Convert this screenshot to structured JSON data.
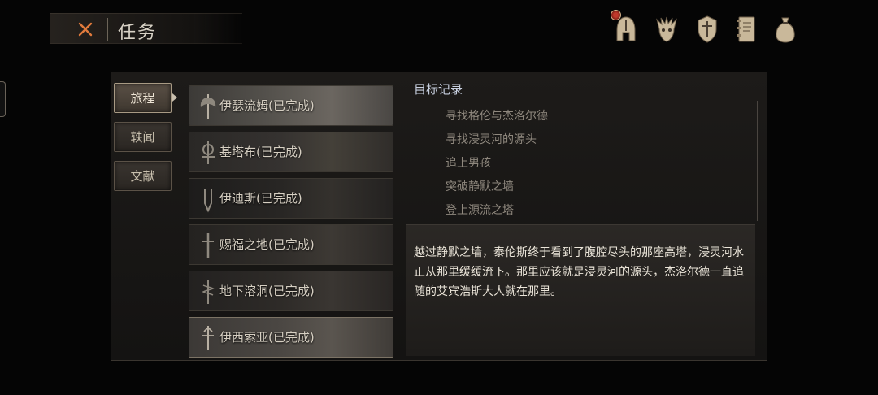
{
  "header": {
    "title": "任务"
  },
  "top_icons": [
    {
      "name": "helmet-icon"
    },
    {
      "name": "beast-skull-icon"
    },
    {
      "name": "shield-icon"
    },
    {
      "name": "journal-icon"
    },
    {
      "name": "pouch-icon"
    }
  ],
  "tabs": [
    {
      "label": "旅程",
      "active": true
    },
    {
      "label": "轶闻",
      "active": false
    },
    {
      "label": "文献",
      "active": false
    }
  ],
  "quests": [
    {
      "label": "伊瑟流姆(已完成)",
      "icon": "axe-emblem-icon"
    },
    {
      "label": "基塔布(已完成)",
      "icon": "ornate-emblem-icon"
    },
    {
      "label": "伊迪斯(已完成)",
      "icon": "stake-emblem-icon"
    },
    {
      "label": "赐福之地(已完成)",
      "icon": "sword-emblem-icon"
    },
    {
      "label": "地下溶洞(已完成)",
      "icon": "serpent-staff-icon"
    },
    {
      "label": "伊西索亚(已完成)",
      "icon": "dagger-emblem-icon"
    }
  ],
  "objectives_title": "目标记录",
  "objectives": [
    "寻找格伦与杰洛尔德",
    "寻找浸灵河的源头",
    "追上男孩",
    "突破静默之墙",
    "登上源流之塔"
  ],
  "description": "越过静默之墙，泰伦斯终于看到了腹腔尽头的那座高塔，浸灵河水正从那里缓缓流下。那里应该就是浸灵河的源头，杰洛尔德一直追随的艾宾浩斯大人就在那里。",
  "colors": {
    "accent": "#e07a3c",
    "text": "#d6cfc2",
    "panel": "#1d1b19"
  }
}
